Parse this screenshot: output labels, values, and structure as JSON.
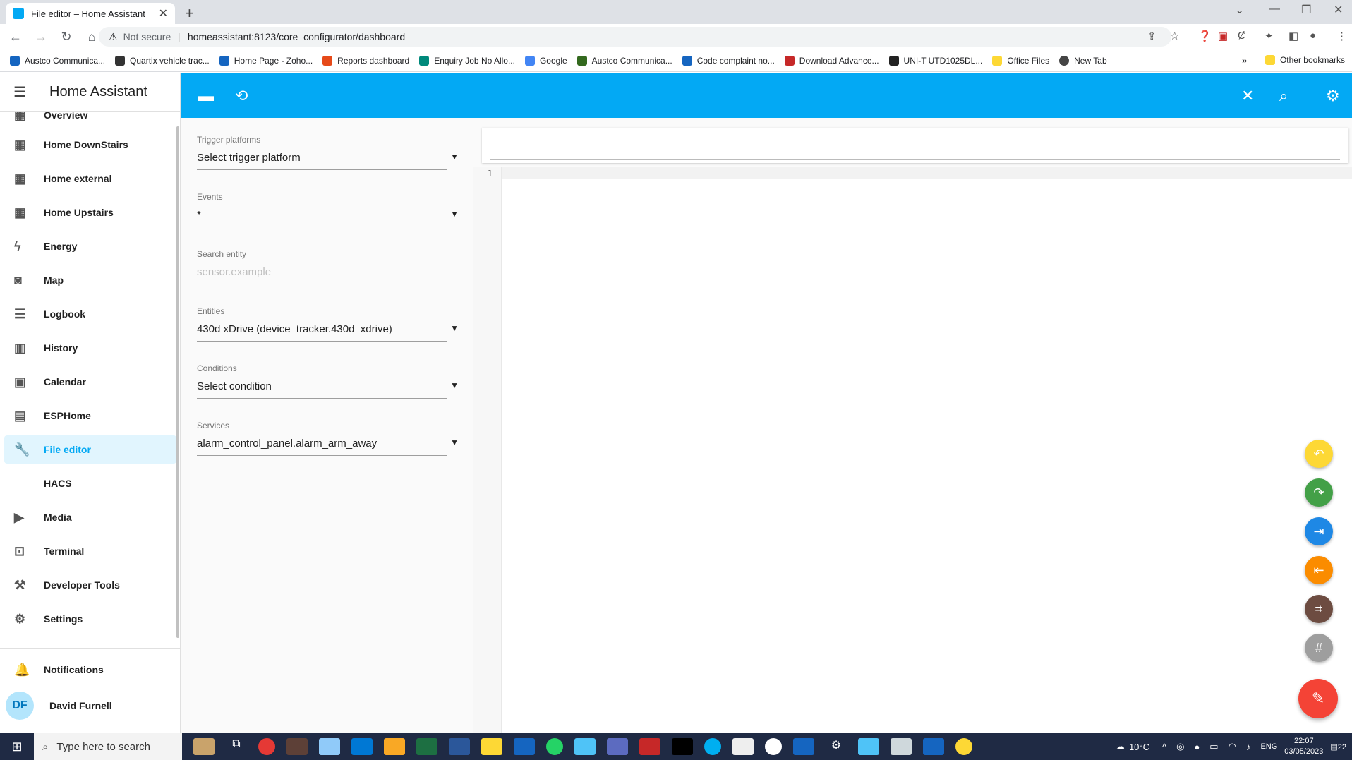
{
  "browser": {
    "tab_title": "File editor – Home Assistant",
    "not_secure": "Not secure",
    "url": "homeassistant:8123/core_configurator/dashboard",
    "bookmarks": [
      {
        "label": "Austco Communica...",
        "color": "#1565c0"
      },
      {
        "label": "Quartix vehicle trac...",
        "color": "#333333"
      },
      {
        "label": "Home Page - Zoho...",
        "color": "#1565c0"
      },
      {
        "label": "Reports dashboard",
        "color": "#e64a19"
      },
      {
        "label": "Enquiry Job No Allo...",
        "color": "#00897b"
      },
      {
        "label": "Google",
        "color": "#4285f4"
      },
      {
        "label": "Austco Communica...",
        "color": "#33691e"
      },
      {
        "label": "Code complaint no...",
        "color": "#1565c0"
      },
      {
        "label": "Download Advance...",
        "color": "#c62828"
      },
      {
        "label": "UNI-T UTD1025DL...",
        "color": "#222222"
      },
      {
        "label": "Office Files",
        "color": "#fdd835"
      },
      {
        "label": "New Tab",
        "color": "#444444"
      }
    ],
    "other_bookmarks": "Other bookmarks"
  },
  "sidebar": {
    "title": "Home Assistant",
    "items": [
      {
        "label": "Overview",
        "icon": "▦"
      },
      {
        "label": "Home DownStairs",
        "icon": "▦"
      },
      {
        "label": "Home external",
        "icon": "▦"
      },
      {
        "label": "Home Upstairs",
        "icon": "▦"
      },
      {
        "label": "Energy",
        "icon": "ϟ"
      },
      {
        "label": "Map",
        "icon": "◙"
      },
      {
        "label": "Logbook",
        "icon": "☰"
      },
      {
        "label": "History",
        "icon": "▥"
      },
      {
        "label": "Calendar",
        "icon": "▣"
      },
      {
        "label": "ESPHome",
        "icon": "▤"
      },
      {
        "label": "File editor",
        "icon": "🔧"
      },
      {
        "label": "HACS",
        "icon": ""
      },
      {
        "label": "Media",
        "icon": "▶"
      },
      {
        "label": "Terminal",
        "icon": "⊡"
      },
      {
        "label": "Developer Tools",
        "icon": "⚒"
      },
      {
        "label": "Settings",
        "icon": "⚙"
      }
    ],
    "notifications": "Notifications",
    "user_initials": "DF",
    "user_name": "David Furnell"
  },
  "form": {
    "trigger_label": "Trigger platforms",
    "trigger_value": "Select trigger platform",
    "events_label": "Events",
    "events_value": "*",
    "search_label": "Search entity",
    "search_placeholder": "sensor.example",
    "entities_label": "Entities",
    "entities_value": "430d xDrive (device_tracker.430d_xdrive)",
    "conditions_label": "Conditions",
    "conditions_value": "Select condition",
    "services_label": "Services",
    "services_value": "alarm_control_panel.alarm_arm_away"
  },
  "editor": {
    "line_number": "1"
  },
  "colors": {
    "accent": "#03a9f4",
    "fab_undo": "#fdd835",
    "fab_redo": "#43a047",
    "fab_indent": "#1e88e5",
    "fab_outdent": "#fb8c00",
    "fab_fold": "#6d4c41",
    "fab_hash": "#9e9e9e",
    "fab_edit": "#f44336"
  },
  "taskbar": {
    "search_placeholder": "Type here to search",
    "weather": "10°C",
    "language": "ENG",
    "time": "22:07",
    "date": "03/05/2023",
    "notif_count": "22"
  }
}
